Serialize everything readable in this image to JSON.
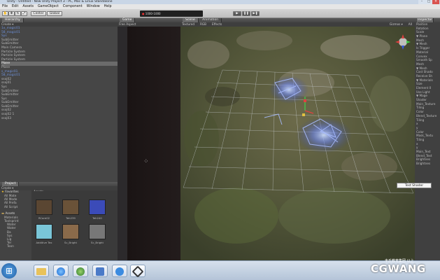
{
  "window": {
    "title": "Unity - Untitled - New Unity Project 3 - PC, Mac & Linux Standalone",
    "minimize": "–",
    "maximize": "□",
    "close": "✕"
  },
  "menu": [
    "File",
    "Edit",
    "Assets",
    "GameObject",
    "Component",
    "Window",
    "Help"
  ],
  "toolbar": {
    "center": "Center",
    "global": "Global",
    "play": "▶",
    "pause": "❚❚",
    "step": "▶❚",
    "layout_hint": "1000-1000"
  },
  "hierarchy": {
    "tab": "Hierarchy",
    "create": "Create ▾",
    "items": [
      {
        "label": "1x_magic01",
        "cls": "blue"
      },
      {
        "label": "    58_magic01",
        "cls": "blue"
      },
      {
        "label": "  Sys",
        "cls": "blue"
      },
      {
        "label": "      SubEmitter",
        "cls": ""
      },
      {
        "label": "      SubEmitter",
        "cls": ""
      },
      {
        "label": "  Main Camera",
        "cls": ""
      },
      {
        "label": "  Particle System",
        "cls": ""
      },
      {
        "label": "      Particle System",
        "cls": ""
      },
      {
        "label": "      Particle System",
        "cls": ""
      },
      {
        "label": "  Plane",
        "cls": "sel"
      },
      {
        "label": "  Plane",
        "cls": ""
      },
      {
        "label": "    s_magic01",
        "cls": "blue"
      },
      {
        "label": "      58_magic01",
        "cls": "blue"
      },
      {
        "label": "  ssoj02",
        "cls": ""
      },
      {
        "label": "  ssoj01",
        "cls": ""
      },
      {
        "label": "    Sys",
        "cls": ""
      },
      {
        "label": "      SubEmitter",
        "cls": ""
      },
      {
        "label": "      SubEmitter",
        "cls": ""
      },
      {
        "label": "    Sys",
        "cls": ""
      },
      {
        "label": "      SubEmitter",
        "cls": ""
      },
      {
        "label": "      SubEmitter",
        "cls": ""
      },
      {
        "label": "    ssoj02",
        "cls": ""
      },
      {
        "label": "    ssoj02 1",
        "cls": ""
      },
      {
        "label": "  ssoj03",
        "cls": ""
      }
    ]
  },
  "project": {
    "tab": "Project",
    "create": "Create ▾",
    "favorites_title": "Favorites",
    "favorites": [
      "All Mate",
      "All Mode",
      "All Prefa",
      "All Script"
    ],
    "assets_title": "Assets",
    "tree": [
      "Materials",
      "Toolsprint",
      "Water",
      "Water",
      "Ba",
      "Sys",
      "Lig",
      "Ter",
      "Toon"
    ],
    "breadcrumb": "Assets ▸",
    "thumbs": [
      {
        "label": "RCore02",
        "color": "#5a4632"
      },
      {
        "label": "Teh239",
        "color": "#6a5238"
      },
      {
        "label": "Teh240",
        "color": "#3b4bb8"
      },
      {
        "label": "Additive Tex",
        "color": "#7ac6d8"
      },
      {
        "label": "Sc_Bright",
        "color": "#8a6a4a"
      },
      {
        "label": "Sc_Bright",
        "color": "#777777"
      }
    ]
  },
  "game": {
    "tab": "Game",
    "aspect": "Free Aspect"
  },
  "scene": {
    "tab_scene": "Scene",
    "tab_anim": "Animation",
    "shading": "Textured",
    "rgb": "RGB",
    "effects": "Effects",
    "gizmos": "Gizmos ▾",
    "search": "All"
  },
  "inspector": {
    "tab": "Inspector",
    "rows": [
      "Position",
      "Rotation",
      "Scale",
      "▼ Plane",
      "Mesh",
      "▼ Mesh",
      "Is Trigger",
      "Material",
      "Convex",
      "Smooth Sp",
      "Mesh",
      "▼ Mesh",
      "Cast Shado",
      "Receive Sh",
      "▼ Materials",
      "Size",
      "Element 0",
      "Use Light",
      "▼ Mage",
      "Shader",
      "Main_Texture",
      "Tiling",
      "Color",
      "Blend_Texture",
      "Tiling",
      "x",
      "y",
      "Color",
      "Mask_Textu",
      "Tiling",
      "x",
      "y",
      "Main_Text",
      "Blend_Text",
      "Brightnes",
      "Brightnes"
    ]
  },
  "tooltip": "Test Shader",
  "watermark": {
    "top": "丰氏教育集团 以上",
    "brand": "CGWANG"
  },
  "taskbar": {
    "start": "⊞"
  },
  "colors": {
    "scene_ground": "#5f5a3e",
    "glow": "#8fa8ff",
    "accent": "#6d8fd6"
  }
}
